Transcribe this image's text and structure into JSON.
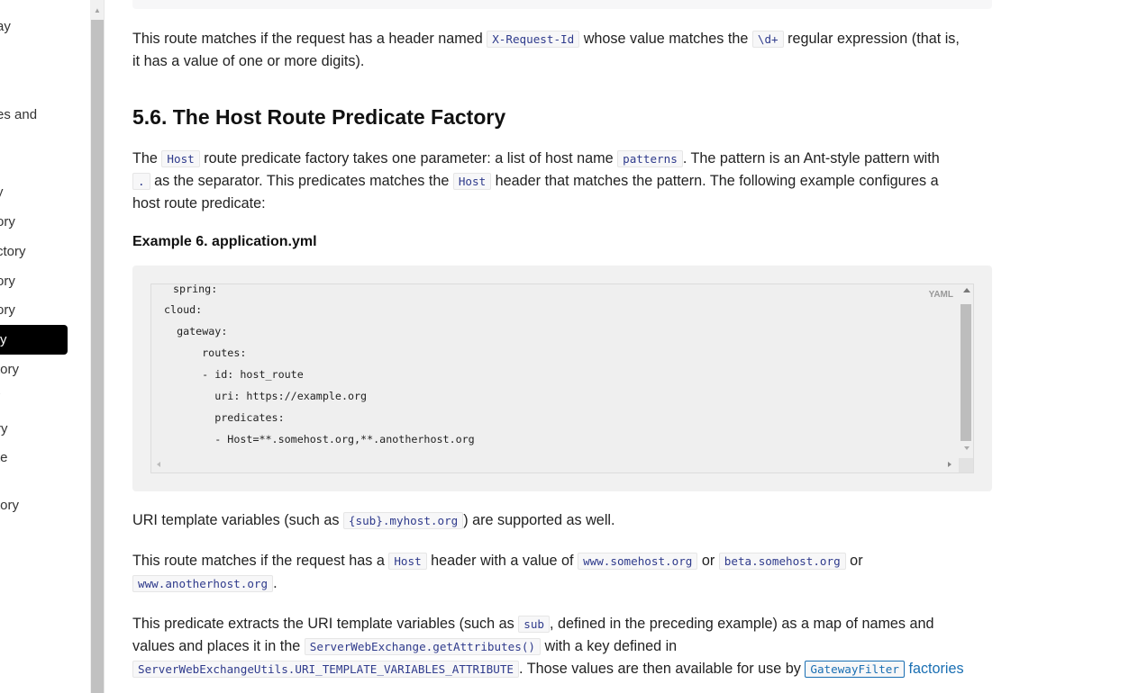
{
  "sidebar": {
    "items": [
      {
        "label": "ay"
      },
      {
        "label": "es and"
      },
      {
        "label": "y"
      },
      {
        "label": "ory"
      },
      {
        "label": "ctory"
      },
      {
        "label": "ory"
      },
      {
        "label": "ory"
      },
      {
        "label": "y"
      },
      {
        "label": "tory"
      },
      {
        "label": "/"
      },
      {
        "label": "ry"
      },
      {
        "label": "te"
      },
      {
        "label": "tory"
      }
    ]
  },
  "content": {
    "prev_para": {
      "t1": "This route matches if the request has a header named ",
      "c1": "X-Request-Id",
      "t2": " whose value matches the ",
      "c2": "\\d+",
      "t3": " regular expression (that is,",
      "t4": "it has a value of one or more digits)."
    },
    "section_title": "5.6. The Host Route Predicate Factory",
    "intro": {
      "t1": "The ",
      "c1": "Host",
      "t2": " route predicate factory takes one parameter: a list of host name ",
      "c2": "patterns",
      "t3": ". The pattern is an Ant-style pattern with",
      "c3": ".",
      "t4": " as the separator. This predicates matches the ",
      "c4": "Host",
      "t5": " header that matches the pattern. The following example configures a",
      "t6": "host route predicate:"
    },
    "example_title": "Example 6. application.yml",
    "code": {
      "lang": "YAML",
      "lines": [
        "spring:",
        "cloud:",
        "  gateway:",
        "    routes:",
        "    - id: host_route",
        "      uri: https://example.org",
        "      predicates:",
        "      - Host=**.somehost.org,**.anotherhost.org"
      ]
    },
    "uri_para": {
      "t1": "URI template variables (such as ",
      "c1": "{sub}.myhost.org",
      "t2": ") are supported as well."
    },
    "match_para": {
      "t1": "This route matches if the request has a ",
      "c1": "Host",
      "t2": " header with a value of ",
      "c2": "www.somehost.org",
      "t3": " or ",
      "c3": "beta.somehost.org",
      "t4": " or",
      "c4": "www.anotherhost.org",
      "t5": "."
    },
    "extract_para": {
      "t1": "This predicate extracts the URI template variables (such as ",
      "c1": "sub",
      "t2": ", defined in the preceding example) as a map of names and",
      "t3": "values and places it in the ",
      "c2": "ServerWebExchange.getAttributes()",
      "t4": " with a key defined in",
      "c3": "ServerWebExchangeUtils.URI_TEMPLATE_VARIABLES_ATTRIBUTE",
      "t5": ". Those values are then available for use by ",
      "link_code": "GatewayFilter",
      "link_text": " factories"
    }
  }
}
